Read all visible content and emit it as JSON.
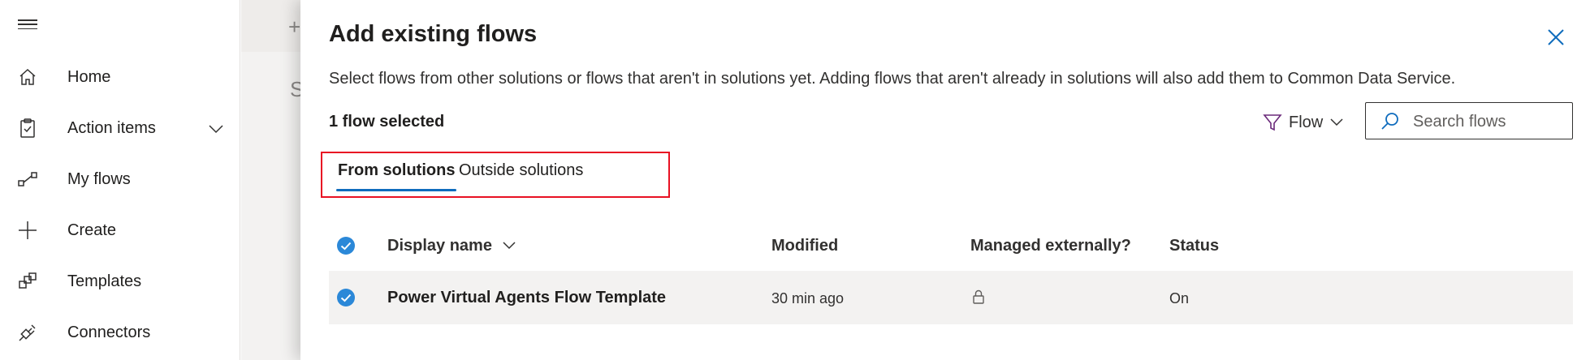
{
  "sidebar": {
    "items": [
      {
        "label": "Home",
        "icon": "home-icon"
      },
      {
        "label": "Action items",
        "icon": "clipboard-icon"
      },
      {
        "label": "My flows",
        "icon": "flow-icon"
      },
      {
        "label": "Create",
        "icon": "plus-icon"
      },
      {
        "label": "Templates",
        "icon": "templates-icon"
      },
      {
        "label": "Connectors",
        "icon": "connector-icon"
      }
    ]
  },
  "background": {
    "plus_glyph": "+",
    "partial_letter": "S"
  },
  "panel": {
    "title": "Add existing flows",
    "description": "Select flows from other solutions or flows that aren't in solutions yet. Adding flows that aren't already in solutions will also add them to Common Data Service.",
    "selected_count": "1 flow selected",
    "filter_label": "Flow",
    "search_placeholder": "Search flows",
    "tabs": [
      {
        "label": "From solutions",
        "active": true
      },
      {
        "label": "Outside solutions",
        "active": false
      }
    ],
    "table": {
      "columns": [
        "Display name",
        "Modified",
        "Managed externally?",
        "Status"
      ],
      "rows": [
        {
          "name": "Power Virtual Agents Flow Template",
          "modified": "30 min ago",
          "managed_icon": "lock-icon",
          "status": "On",
          "selected": true
        }
      ]
    }
  },
  "colors": {
    "accent": "#0f6cbd",
    "check": "#2b88d8",
    "highlight_border": "#e81123",
    "filter_icon": "#6b2a7a"
  }
}
